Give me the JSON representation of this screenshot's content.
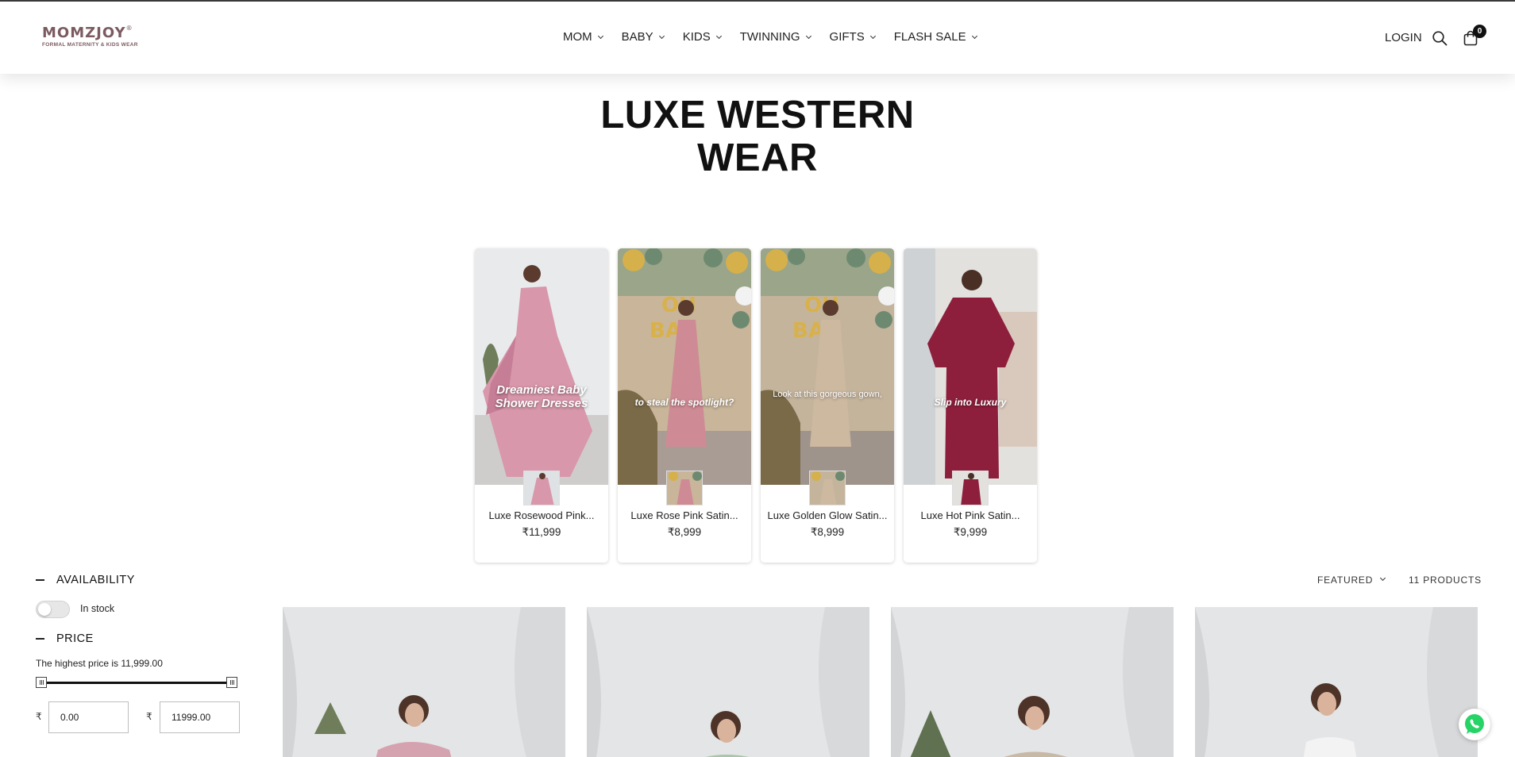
{
  "brand": {
    "name": "MOMZJOY",
    "registered": "®",
    "tagline": "FORMAL MATERNITY & KIDS WEAR",
    "color": "#7b5a60"
  },
  "nav": {
    "items": [
      {
        "label": "MOM"
      },
      {
        "label": "BABY"
      },
      {
        "label": "KIDS"
      },
      {
        "label": "TWINNING"
      },
      {
        "label": "GIFTS"
      },
      {
        "label": "FLASH SALE"
      }
    ],
    "login": "LOGIN",
    "search_icon": "search-icon",
    "cart_icon": "shopping-bag-icon",
    "cart_count": "0"
  },
  "collection": {
    "title_line1": "LUXE WESTERN",
    "title_line2": "WEAR"
  },
  "video_products": [
    {
      "name": "Luxe Rosewood Pink...",
      "price": "₹11,999",
      "caption": "Dreamiest Baby Shower Dresses"
    },
    {
      "name": "Luxe Rose Pink Satin...",
      "price": "₹8,999",
      "caption": "to steal the spotlight?"
    },
    {
      "name": "Luxe Golden Glow Satin...",
      "price": "₹8,999",
      "caption": "Look at this gorgeous gown,"
    },
    {
      "name": "Luxe Hot Pink Satin...",
      "price": "₹9,999",
      "caption": "Slip into Luxury"
    }
  ],
  "filters": {
    "availability_label": "AVAILABILITY",
    "in_stock_label": "In stock",
    "in_stock_on": false,
    "price_label": "PRICE",
    "price_note": "The highest price is 11,999.00",
    "currency": "₹",
    "min_value": "0.00",
    "max_value": "11999.00"
  },
  "sort": {
    "selected": "FEATURED",
    "product_count": "11 PRODUCTS"
  },
  "colors": {
    "accent_dark": "#111111",
    "whatsapp": "#25d366"
  }
}
